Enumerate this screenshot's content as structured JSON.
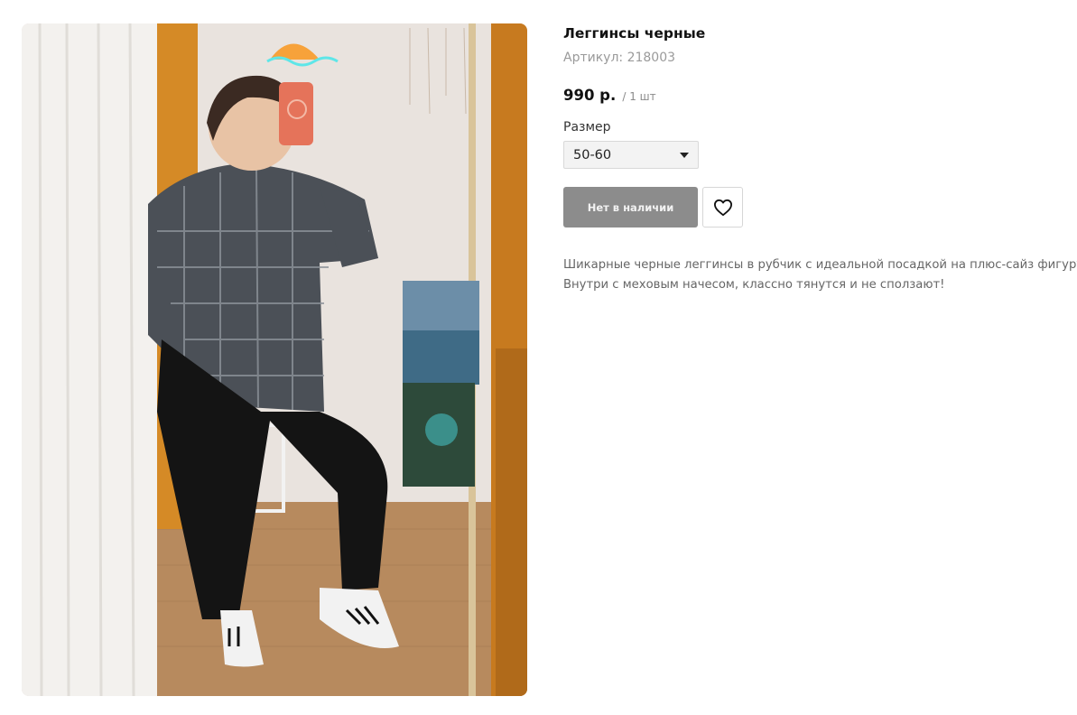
{
  "product": {
    "title": "Леггинсы черные",
    "sku": "Артикул: 218003",
    "price": "990 р.",
    "unit": "/ 1 шт",
    "size_label": "Размер",
    "size_value": "50-60",
    "stock_button": "Нет в наличии",
    "favorite_icon": "heart-icon",
    "description_line1": "Шикарные черные леггинсы в рубчик с идеальной посадкой на плюс-сайз фигуру.",
    "description_line2": "Внутри с меховым начесом, классно тянутся и не сползают!"
  },
  "colors": {
    "disabled_button": "#8c8c8c",
    "price_text": "#111111",
    "muted_text": "#9a9a9a"
  }
}
